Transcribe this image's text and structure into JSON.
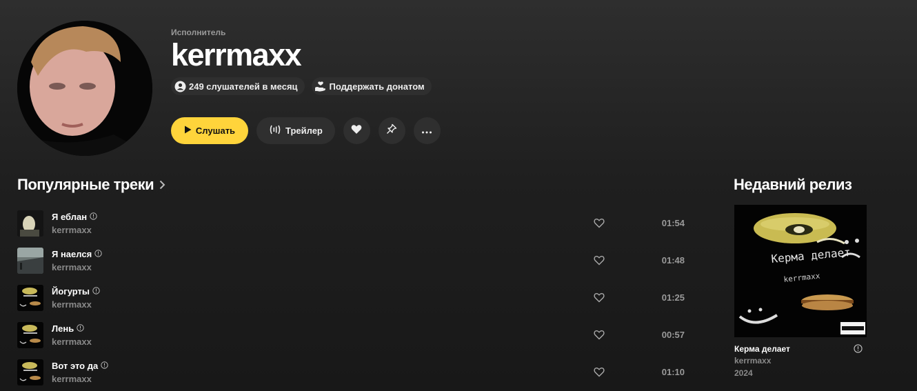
{
  "artist": {
    "kind": "Исполнитель",
    "name": "kerrmaxx",
    "listeners": "249 слушателей в месяц",
    "donate": "Поддержать донатом"
  },
  "actions": {
    "play": "Слушать",
    "trailer": "Трейлер"
  },
  "popular": {
    "title": "Популярные треки",
    "tracks": [
      {
        "title": "Я еблан",
        "artist": "kerrmaxx",
        "duration": "01:54"
      },
      {
        "title": "Я наелся",
        "artist": "kerrmaxx",
        "duration": "01:48"
      },
      {
        "title": "Йогурты",
        "artist": "kerrmaxx",
        "duration": "01:25"
      },
      {
        "title": "Лень",
        "artist": "kerrmaxx",
        "duration": "00:57"
      },
      {
        "title": "Вот это да",
        "artist": "kerrmaxx",
        "duration": "01:10"
      }
    ]
  },
  "recent_release": {
    "title": "Недавний релиз",
    "name": "Керма делает",
    "artist": "kerrmaxx",
    "year": "2024",
    "cover_text": "Керма делает",
    "cover_sub": "kerrmaxx"
  },
  "colors": {
    "accent": "#ffd43b",
    "background": "#1a1a1a",
    "chip": "#2f2f2f",
    "muted_text": "#8a8a8a"
  }
}
